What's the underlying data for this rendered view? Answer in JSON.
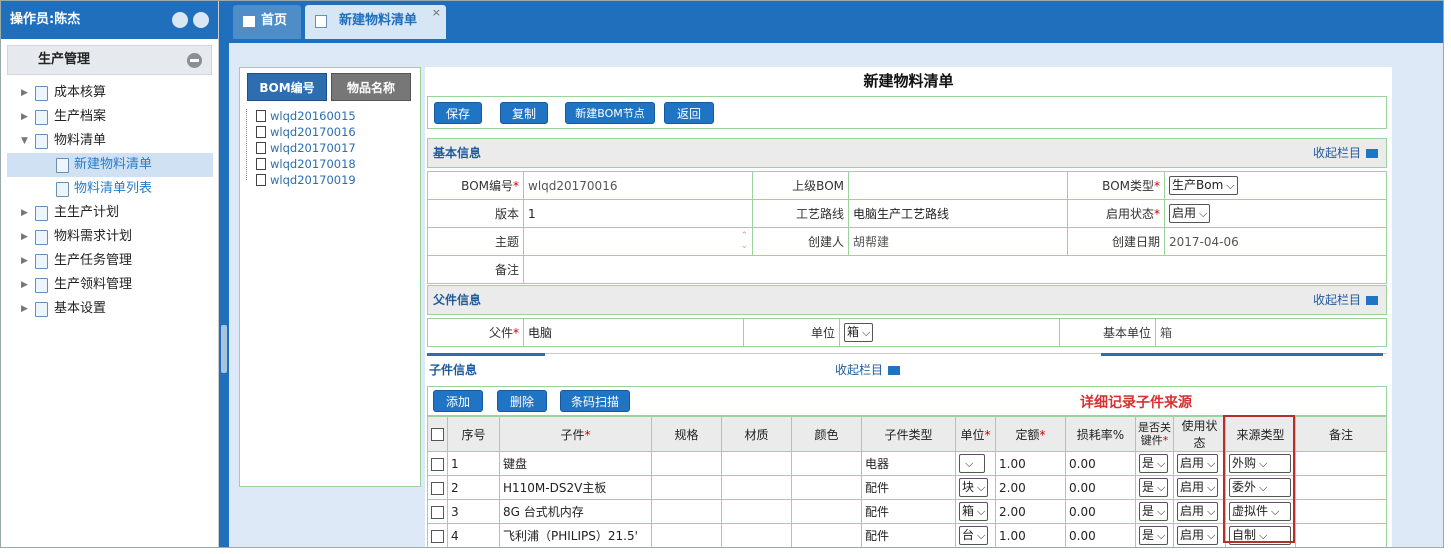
{
  "operator": "操作员:陈杰",
  "sidebar": {
    "group": "生产管理",
    "items": [
      {
        "label": "成本核算",
        "arrow": "▶"
      },
      {
        "label": "生产档案",
        "arrow": "▶"
      },
      {
        "label": "物料清单",
        "arrow": "▼"
      },
      {
        "label": "新建物料清单",
        "sub": true,
        "selected": true
      },
      {
        "label": "物料清单列表",
        "sub": true
      },
      {
        "label": "主生产计划",
        "arrow": "▶"
      },
      {
        "label": "物料需求计划",
        "arrow": "▶"
      },
      {
        "label": "生产任务管理",
        "arrow": "▶"
      },
      {
        "label": "生产领料管理",
        "arrow": "▶"
      },
      {
        "label": "基本设置",
        "arrow": "▶"
      }
    ]
  },
  "tabs": {
    "home": "首页",
    "active": "新建物料清单",
    "close": "×"
  },
  "bom_list": {
    "tab_a": "BOM编号",
    "tab_b": "物品名称",
    "items": [
      "wlqd20160015",
      "wlqd20170016",
      "wlqd20170017",
      "wlqd20170018",
      "wlqd20170019"
    ]
  },
  "form": {
    "title": "新建物料清单",
    "toolbar": {
      "save": "保存",
      "copy": "复制",
      "new_node": "新建BOM节点",
      "back": "返回"
    },
    "basic": {
      "title": "基本信息",
      "collapse": "收起栏目",
      "bom_no_label": "BOM编号",
      "bom_no": "wlqd20170016",
      "parent_bom_label": "上级BOM",
      "parent_bom": "",
      "bom_type_label": "BOM类型",
      "bom_type": "生产Bom",
      "version_label": "版本",
      "version": "1",
      "route_label": "工艺路线",
      "route": "电脑生产工艺路线",
      "status_label": "启用状态",
      "status": "启用",
      "subject_label": "主题",
      "subject": "",
      "creator_label": "创建人",
      "creator": "胡帮建",
      "created_label": "创建日期",
      "created": "2017-04-06",
      "remark_label": "备注",
      "remark": ""
    },
    "parent": {
      "title": "父件信息",
      "collapse": "收起栏目",
      "item_label": "父件",
      "item": "电脑",
      "unit_label": "单位",
      "unit": "箱",
      "base_unit_label": "基本单位",
      "base_unit": "箱"
    },
    "child": {
      "title": "子件信息",
      "collapse": "收起栏目",
      "add": "添加",
      "delete": "删除",
      "scan": "条码扫描",
      "note": "详细记录子件来源",
      "headers": [
        "序号",
        "子件",
        "规格",
        "材质",
        "颜色",
        "子件类型",
        "单位",
        "定额",
        "损耗率%",
        "是否关键件",
        "使用状态",
        "来源类型",
        "备注"
      ],
      "rows": [
        {
          "no": "1",
          "item": "键盘",
          "type": "电器",
          "unit": "",
          "qty": "1.00",
          "loss": "0.00",
          "key": "是",
          "use": "启用",
          "src": "外购"
        },
        {
          "no": "2",
          "item": "H110M-DS2V主板",
          "type": "配件",
          "unit": "块",
          "qty": "2.00",
          "loss": "0.00",
          "key": "是",
          "use": "启用",
          "src": "委外"
        },
        {
          "no": "3",
          "item": "8G 台式机内存",
          "type": "配件",
          "unit": "箱",
          "qty": "2.00",
          "loss": "0.00",
          "key": "是",
          "use": "启用",
          "src": "虚拟件"
        },
        {
          "no": "4",
          "item": "飞利浦（PHILIPS）21.5'",
          "type": "配件",
          "unit": "台",
          "qty": "1.00",
          "loss": "0.00",
          "key": "是",
          "use": "启用",
          "src": "自制"
        }
      ]
    }
  },
  "colors": {
    "brand": "#1f6fbd",
    "border": "#9bd39b",
    "note": "#d63030"
  }
}
